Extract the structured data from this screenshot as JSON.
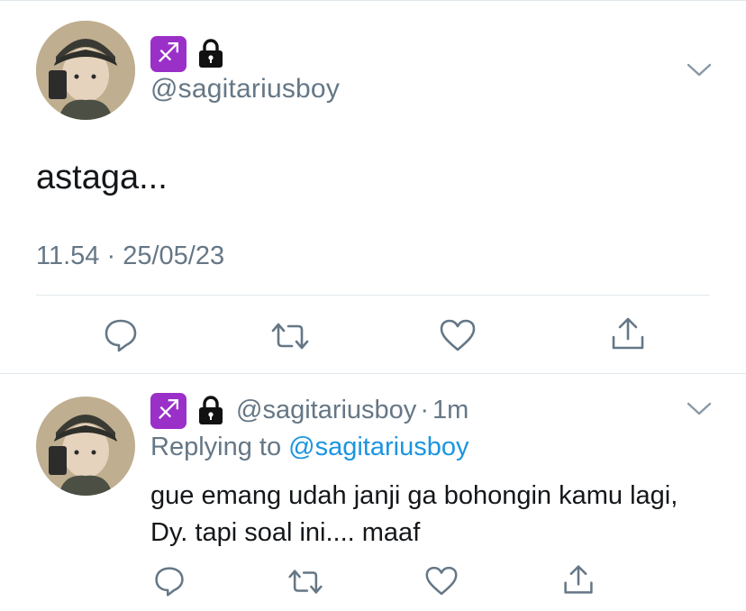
{
  "main_tweet": {
    "badge_glyph": "♐",
    "handle": "@sagitariusboy",
    "text": "astaga...",
    "timestamp": "11.54 · 25/05/23"
  },
  "reply": {
    "badge_glyph": "♐",
    "handle": "@sagitariusboy",
    "separator": "·",
    "time": "1m",
    "replying_prefix": "Replying to",
    "replying_to": "@sagitariusboy",
    "text": "gue emang udah janji ga bohongin kamu lagi, Dy. tapi soal ini.... maaf"
  },
  "icons": [
    "reply-icon",
    "retweet-icon",
    "like-icon",
    "share-icon",
    "lock-icon",
    "chevron-down-icon"
  ],
  "colors": {
    "badge": "#9b30c9",
    "secondary_text": "#657786",
    "link": "#1b95e0",
    "divider": "#e1e8ed"
  }
}
